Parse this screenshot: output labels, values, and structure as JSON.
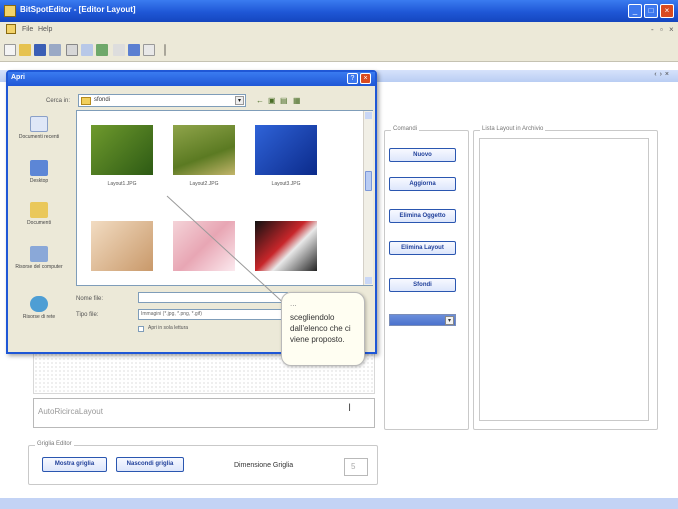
{
  "window": {
    "title": "BitSpotEditor - [Editor Layout]"
  },
  "menu": {
    "items": [
      "File",
      "Help"
    ]
  },
  "dialog": {
    "title": "Apri",
    "look_in_label": "Cerca in:",
    "look_in_value": "sfondi",
    "places": [
      "Documenti recenti",
      "Desktop",
      "Documenti",
      "Risorse del computer",
      "Risorse di rete"
    ],
    "files": [
      {
        "name": "Layout1.JPG"
      },
      {
        "name": "Layout2.JPG"
      },
      {
        "name": "Layout3.JPG"
      },
      {
        "name": ""
      },
      {
        "name": ""
      },
      {
        "name": ""
      }
    ],
    "filename_label": "Nome file:",
    "filetype_label": "Tipo file:",
    "filetype_value": "Immagini (*.jpg, *.png, *.gif)",
    "readonly_label": "Apri in sola lettura"
  },
  "callout": {
    "dots": "...",
    "text": "scegliendolo dall'elenco che ci viene proposto."
  },
  "comandi": {
    "title": "Comandi",
    "buttons": [
      "Nuovo",
      "Aggiorna",
      "Elimina Oggetto",
      "Elimina Layout",
      "Sfondi"
    ]
  },
  "layout_list": {
    "title": "Lista Layout in Archivio"
  },
  "editor": {
    "textarea_value": "AutoRicircaLayout"
  },
  "griglia": {
    "title": "Griglia Editor",
    "show_button": "Mostra griglia",
    "hide_button": "Nascondi griglia",
    "size_label": "Dimensione Griglia",
    "size_value": "5"
  },
  "colors": {
    "titlebar": "#1f57d6",
    "chrome": "#ece9d8",
    "close": "#d94b21",
    "button_text": "#1f3f9a"
  }
}
